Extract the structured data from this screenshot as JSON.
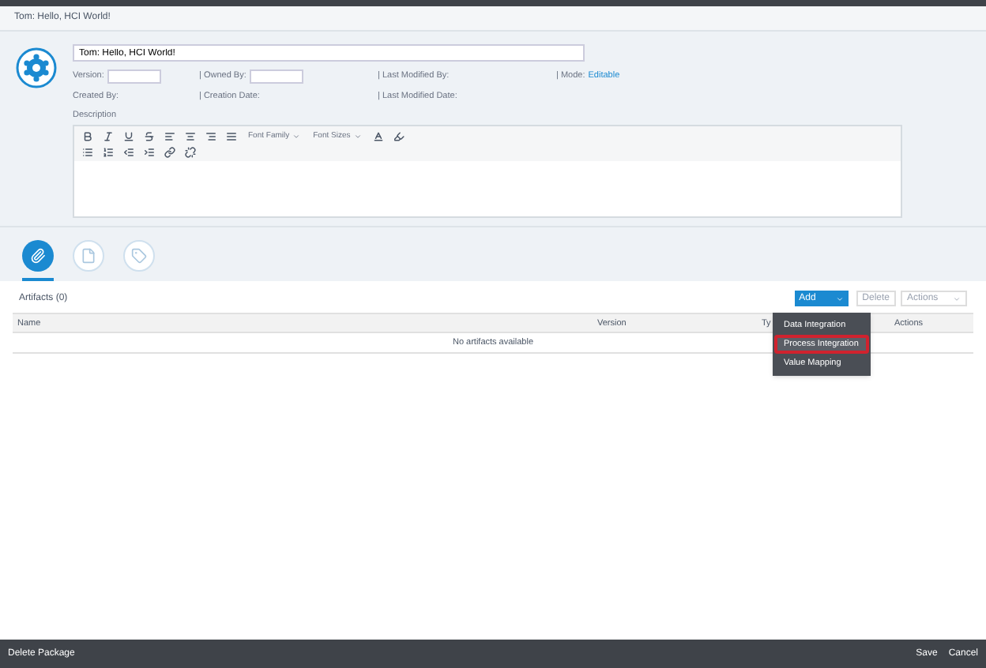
{
  "page_title": "Tom: Hello, HCI World!",
  "name_field": {
    "value": "Tom: Hello, HCI World!"
  },
  "fields": [
    {
      "label": "Version:",
      "kind": "input"
    },
    {
      "label": "| Owned By:",
      "kind": "input"
    },
    {
      "label": "| Last Modified By:",
      "kind": "text"
    },
    {
      "label": "| Mode:",
      "kind": "link",
      "value": "Editable"
    },
    {
      "label": "Created By:",
      "kind": "text"
    },
    {
      "label": "| Creation Date:",
      "kind": "text"
    },
    {
      "label": "| Last Modified Date:",
      "kind": "text"
    }
  ],
  "description": {
    "label": "Description",
    "font_family": "Font Family",
    "font_sizes": "Font Sizes"
  },
  "tabs": [
    {
      "selected": true
    },
    {
      "selected": false
    },
    {
      "selected": false
    }
  ],
  "artifacts": {
    "title": "Artifacts (0)",
    "add": "Add",
    "delete": "Delete",
    "actions": "Actions",
    "columns": [
      "Name",
      "Version",
      "Ty",
      "Actions"
    ],
    "empty": "No artifacts available",
    "menu": [
      {
        "label": "Data Integration",
        "selected": false
      },
      {
        "label": "Process Integration",
        "selected": true
      },
      {
        "label": "Value Mapping",
        "selected": false
      }
    ]
  },
  "footer": {
    "left": "Delete Package",
    "buttons": [
      "Save",
      "Cancel"
    ]
  }
}
